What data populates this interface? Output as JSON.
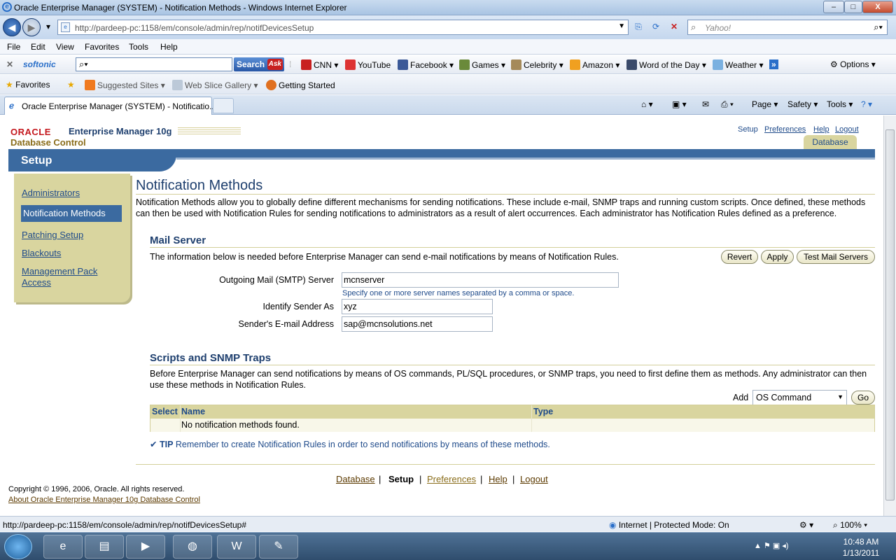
{
  "window": {
    "title": "Oracle Enterprise Manager (SYSTEM) - Notification Methods - Windows Internet Explorer",
    "min": "–",
    "max": "□",
    "close": "X"
  },
  "addressbar": {
    "url": "http://pardeep-pc:1158/em/console/admin/rep/notifDevicesSetup",
    "search_placeholder": "Yahoo!"
  },
  "menu": [
    "File",
    "Edit",
    "View",
    "Favorites",
    "Tools",
    "Help"
  ],
  "softonic": {
    "brand": "softonic",
    "search_btn": "Search",
    "ask": "Ask",
    "links": [
      "CNN",
      "YouTube",
      "Facebook",
      "Games",
      "Celebrity",
      "Amazon",
      "Word of the Day",
      "Weather"
    ],
    "options": "Options"
  },
  "favorites": {
    "label": "Favorites",
    "items": [
      "Suggested Sites",
      "Web Slice Gallery",
      "Getting Started"
    ]
  },
  "tab": {
    "title": "Oracle Enterprise Manager (SYSTEM) - Notificatio...",
    "commands": [
      "Page",
      "Safety",
      "Tools"
    ]
  },
  "em": {
    "oracle": "ORACLE",
    "product": "Enterprise Manager 10g",
    "subtitle": "Database Control",
    "toplinks": [
      "Setup",
      "Preferences",
      "Help",
      "Logout"
    ],
    "db_tab": "Database",
    "section": "Setup",
    "sidenav": [
      "Administrators",
      "Notification Methods",
      "Patching Setup",
      "Blackouts",
      "Management Pack",
      "Access"
    ],
    "page_title": "Notification Methods",
    "page_desc": "Notification Methods allow you to globally define different mechanisms for sending notifications. These include e-mail, SNMP traps and running custom scripts. Once defined, these methods can then be used with Notification Rules for sending notifications to administrators as a result of alert occurrences. Each administrator has Notification Rules defined as a preference.",
    "mail": {
      "title": "Mail Server",
      "desc": "The information below is needed before Enterprise Manager can send e-mail notifications by means of Notification Rules.",
      "revert": "Revert",
      "apply": "Apply",
      "test": "Test Mail Servers",
      "smtp_label": "Outgoing Mail (SMTP) Server",
      "smtp_value": "mcnserver",
      "smtp_hint": "Specify one or more server names separated by a comma or space.",
      "sender_label": "Identify Sender As",
      "sender_value": "xyz",
      "email_label": "Sender's E-mail Address",
      "email_value": "sap@mcnsolutions.net"
    },
    "scripts": {
      "title": "Scripts and SNMP Traps",
      "desc": "Before Enterprise Manager can send notifications by means of OS commands, PL/SQL procedures, or SNMP traps, you need to first define them as methods. Any administrator can then use these methods in Notification Rules.",
      "add_label": "Add",
      "add_value": "OS Command",
      "go": "Go",
      "columns": [
        "Select",
        "Name",
        "Type"
      ],
      "empty": "No notification methods found."
    },
    "tip_label": "TIP",
    "tip": "Remember to create Notification Rules in order to send notifications by means of these methods.",
    "footer_links": [
      "Database",
      "Setup",
      "Preferences",
      "Help",
      "Logout"
    ],
    "copyright": "Copyright © 1996, 2006, Oracle. All rights reserved.",
    "about": "About Oracle Enterprise Manager 10g Database Control"
  },
  "status": {
    "url": "http://pardeep-pc:1158/em/console/admin/rep/notifDevicesSetup#",
    "zone": "Internet | Protected Mode: On",
    "zoom": "100%"
  },
  "taskbar": {
    "time": "10:48 AM",
    "date": "1/13/2011"
  },
  "colors": {
    "oracle_red": "#c4171d",
    "em_blue": "#3b6aa0",
    "em_khaki": "#d9d59f"
  }
}
